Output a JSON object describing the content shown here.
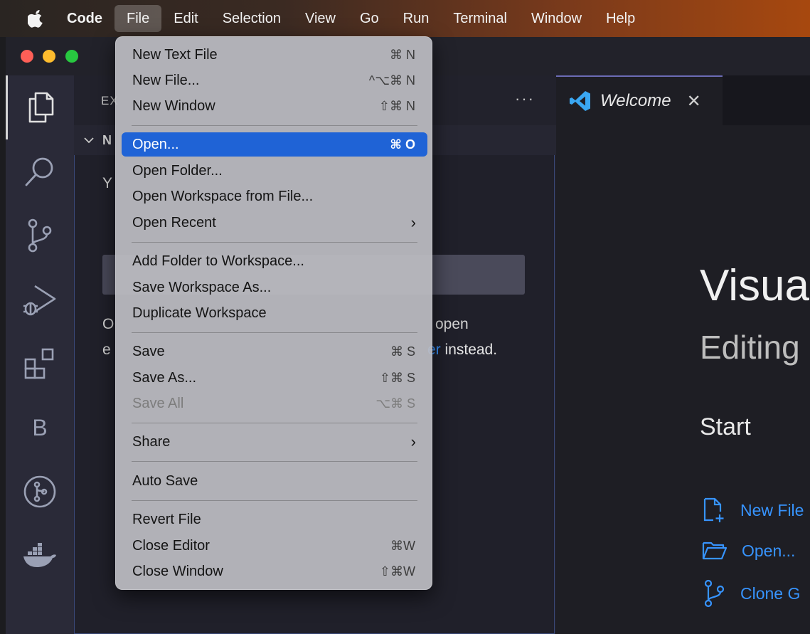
{
  "menubar": {
    "apple_icon": "apple-logo-icon",
    "items": [
      "Code",
      "File",
      "Edit",
      "Selection",
      "View",
      "Go",
      "Run",
      "Terminal",
      "Window",
      "Help"
    ],
    "active": "File"
  },
  "sidebar": {
    "header_title": "EX",
    "more_label": "···",
    "section_label": "N",
    "text_line1": "Y",
    "text_line2_start": "O",
    "text_line2_end": "open",
    "text_line3_start": "e",
    "text_line3_link": "er",
    "text_line3_end": " instead."
  },
  "editor": {
    "tab_label": "Welcome",
    "tab_close": "✕",
    "title": "Visua",
    "subtitle": "Editing",
    "start_heading": "Start",
    "start_items": [
      "New File",
      "Open...",
      "Clone G"
    ]
  },
  "file_menu": {
    "items": [
      {
        "label": "New Text File",
        "shortcut": "⌘ N"
      },
      {
        "label": "New File...",
        "shortcut": "^⌥⌘ N"
      },
      {
        "label": "New Window",
        "shortcut": "⇧⌘ N"
      },
      {
        "label": "Open...",
        "shortcut": "⌘ O",
        "highlighted": true
      },
      {
        "label": "Open Folder...",
        "shortcut": ""
      },
      {
        "label": "Open Workspace from File...",
        "shortcut": ""
      },
      {
        "label": "Open Recent",
        "shortcut": "",
        "submenu": true
      },
      {
        "label": "Add Folder to Workspace...",
        "shortcut": ""
      },
      {
        "label": "Save Workspace As...",
        "shortcut": ""
      },
      {
        "label": "Duplicate Workspace",
        "shortcut": ""
      },
      {
        "label": "Save",
        "shortcut": "⌘ S"
      },
      {
        "label": "Save As...",
        "shortcut": "⇧⌘ S"
      },
      {
        "label": "Save All",
        "shortcut": "⌥⌘ S",
        "disabled": true
      },
      {
        "label": "Share",
        "shortcut": "",
        "submenu": true
      },
      {
        "label": "Auto Save",
        "shortcut": ""
      },
      {
        "label": "Revert File",
        "shortcut": ""
      },
      {
        "label": "Close Editor",
        "shortcut": "⌘W"
      },
      {
        "label": "Close Window",
        "shortcut": "⇧⌘W"
      }
    ],
    "submenu_arrow": "›"
  },
  "activity_bar": {
    "icons": [
      "explorer-icon",
      "search-icon",
      "source-control-icon",
      "run-debug-icon",
      "extensions-icon",
      "b-extension-icon",
      "git-graph-icon",
      "docker-icon"
    ],
    "b_label": "B"
  },
  "colors": {
    "accent": "#1f63d6",
    "link": "#3794ff",
    "traffic_red": "#ff5f57",
    "traffic_yellow": "#febc2e",
    "traffic_green": "#28c840"
  }
}
